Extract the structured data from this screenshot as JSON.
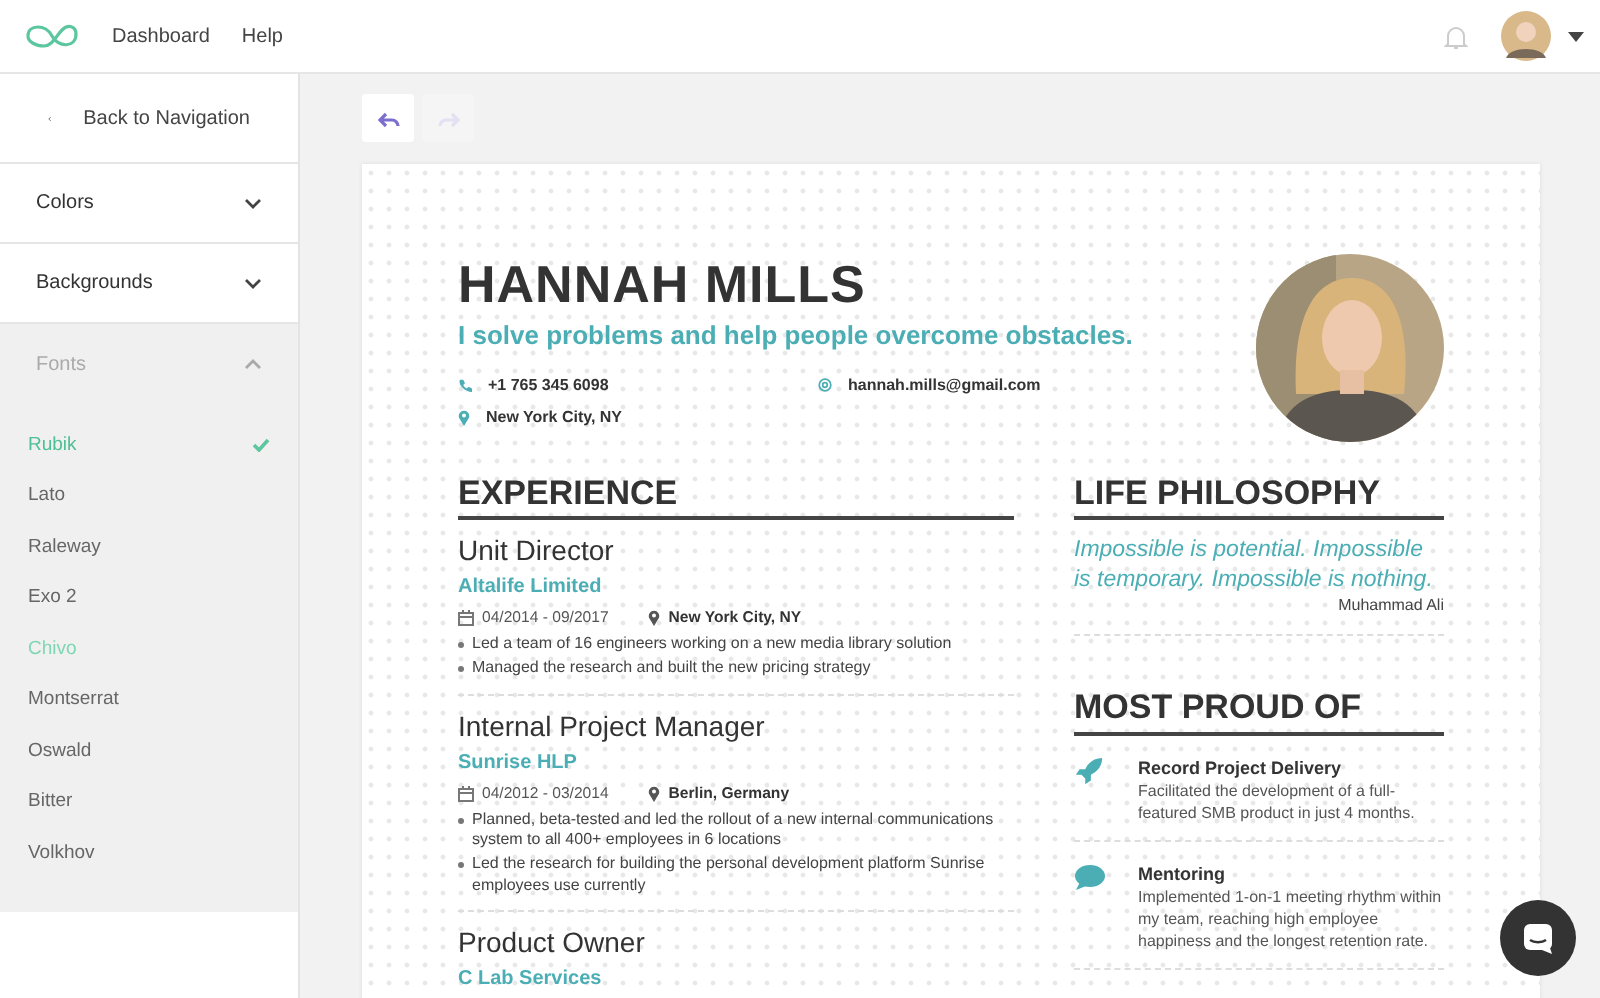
{
  "nav": {
    "links": [
      {
        "label": "Dashboard"
      },
      {
        "label": "Help"
      }
    ]
  },
  "sidebar": {
    "back": "Back to Navigation",
    "sections": [
      {
        "label": "Colors",
        "expanded": false
      },
      {
        "label": "Backgrounds",
        "expanded": false
      },
      {
        "label": "Fonts",
        "expanded": true,
        "items": [
          {
            "label": "Rubik",
            "selected": true,
            "hovered": false
          },
          {
            "label": "Lato",
            "selected": false,
            "hovered": false
          },
          {
            "label": "Raleway",
            "selected": false,
            "hovered": false
          },
          {
            "label": "Exo 2",
            "selected": false,
            "hovered": false
          },
          {
            "label": "Chivo",
            "selected": false,
            "hovered": true
          },
          {
            "label": "Montserrat",
            "selected": false,
            "hovered": false
          },
          {
            "label": "Oswald",
            "selected": false,
            "hovered": false
          },
          {
            "label": "Bitter",
            "selected": false,
            "hovered": false
          },
          {
            "label": "Volkhov",
            "selected": false,
            "hovered": false
          }
        ]
      }
    ]
  },
  "toolbar": {
    "undo": {
      "disabled": false
    },
    "redo": {
      "disabled": true
    }
  },
  "resume": {
    "name": "HANNAH MILLS",
    "tagline": "I solve problems and help people overcome obstacles.",
    "contacts": [
      {
        "kind": "phone",
        "text": "+1 765 345 6098"
      },
      {
        "kind": "email",
        "text": "hannah.mills@gmail.com"
      },
      {
        "kind": "location",
        "text": "New York City, NY"
      }
    ],
    "experience": {
      "heading": "EXPERIENCE",
      "jobs": [
        {
          "title": "Unit Director",
          "company": "Altalife Limited",
          "dates": "04/2014 - 09/2017",
          "location": "New York City, NY",
          "bullets": [
            "Led a team of 16 engineers working on a new media library solution",
            "Managed the research and built the new pricing strategy"
          ]
        },
        {
          "title": "Internal Project Manager",
          "company": "Sunrise HLP",
          "dates": "04/2012 - 03/2014",
          "location": "Berlin, Germany",
          "bullets": [
            "Planned, beta-tested and led the rollout of a new internal communications system to all 400+ employees in 6 locations",
            "Led the research for building the personal development platform Sunrise employees use currently"
          ]
        },
        {
          "title": "Product Owner",
          "company": "C Lab Services"
        }
      ]
    },
    "philosophy": {
      "heading": "LIFE PHILOSOPHY",
      "quote": "Impossible is potential. Impossible is temporary. Impossible is nothing.",
      "author": "Muhammad Ali"
    },
    "proud": {
      "heading": "MOST PROUD OF",
      "items": [
        {
          "kind": "rocket",
          "title": "Record Project Delivery",
          "text": "Facilitated the development of a full-featured SMB product in just 4 months."
        },
        {
          "kind": "speech",
          "title": "Mentoring",
          "text": "Implemented 1-on-1 meeting rhythm within my team, reaching high employee happiness and the longest retention rate."
        }
      ]
    }
  }
}
